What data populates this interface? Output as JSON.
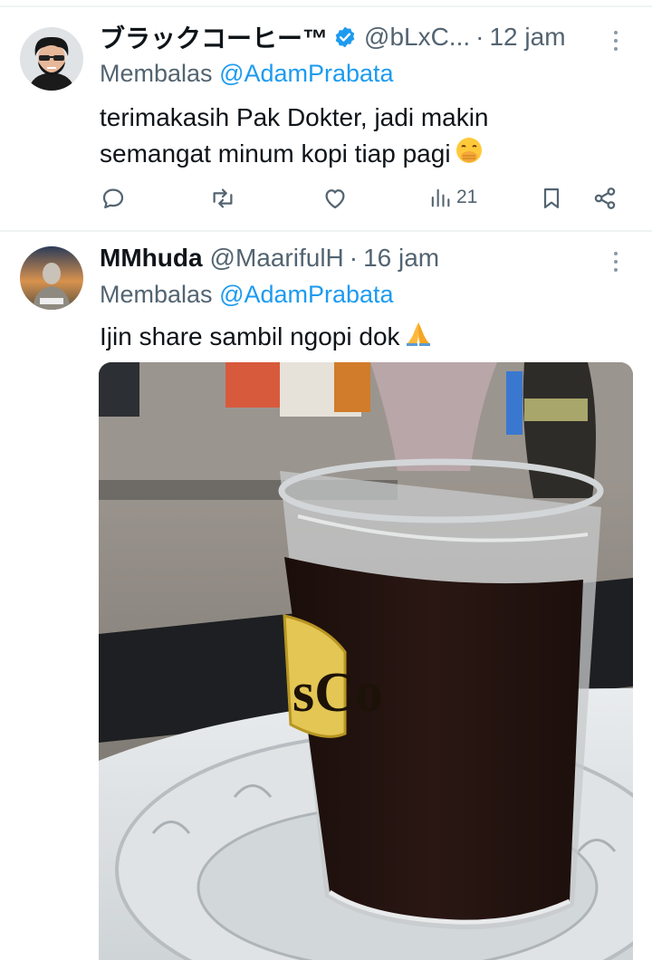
{
  "tweets": [
    {
      "name": "ブラックコーヒー™",
      "verified": true,
      "handle": "@bLxC...",
      "dot": "·",
      "time": "12 jam",
      "reply_prefix": "Membalas",
      "reply_mention": "@AdamPrabata",
      "text": "terimakasih Pak Dokter, jadi makin semangat minum kopi tiap pagi",
      "emoji": "face-with-hand-over-mouth",
      "actions": {
        "reply_icon": "reply-icon",
        "repost_icon": "repost-icon",
        "like_icon": "heart-icon",
        "views_icon": "views-icon",
        "views_count": "21",
        "bookmark_icon": "bookmark-icon",
        "share_icon": "share-icon"
      }
    },
    {
      "name": "MMhuda",
      "handle": "@MaarifulH",
      "dot": "·",
      "time": "16 jam",
      "reply_prefix": "Membalas",
      "reply_mention": "@AdamPrabata",
      "text": "Ijin share sambil ngopi dok",
      "emoji": "folded-hands",
      "photo": "glass-of-black-coffee-on-saucer",
      "photo_label": "sCo"
    }
  ],
  "colors": {
    "link": "#1d9bf0",
    "secondary_text": "#536471",
    "primary_text": "#0f1419",
    "divider": "#eff3f4"
  }
}
